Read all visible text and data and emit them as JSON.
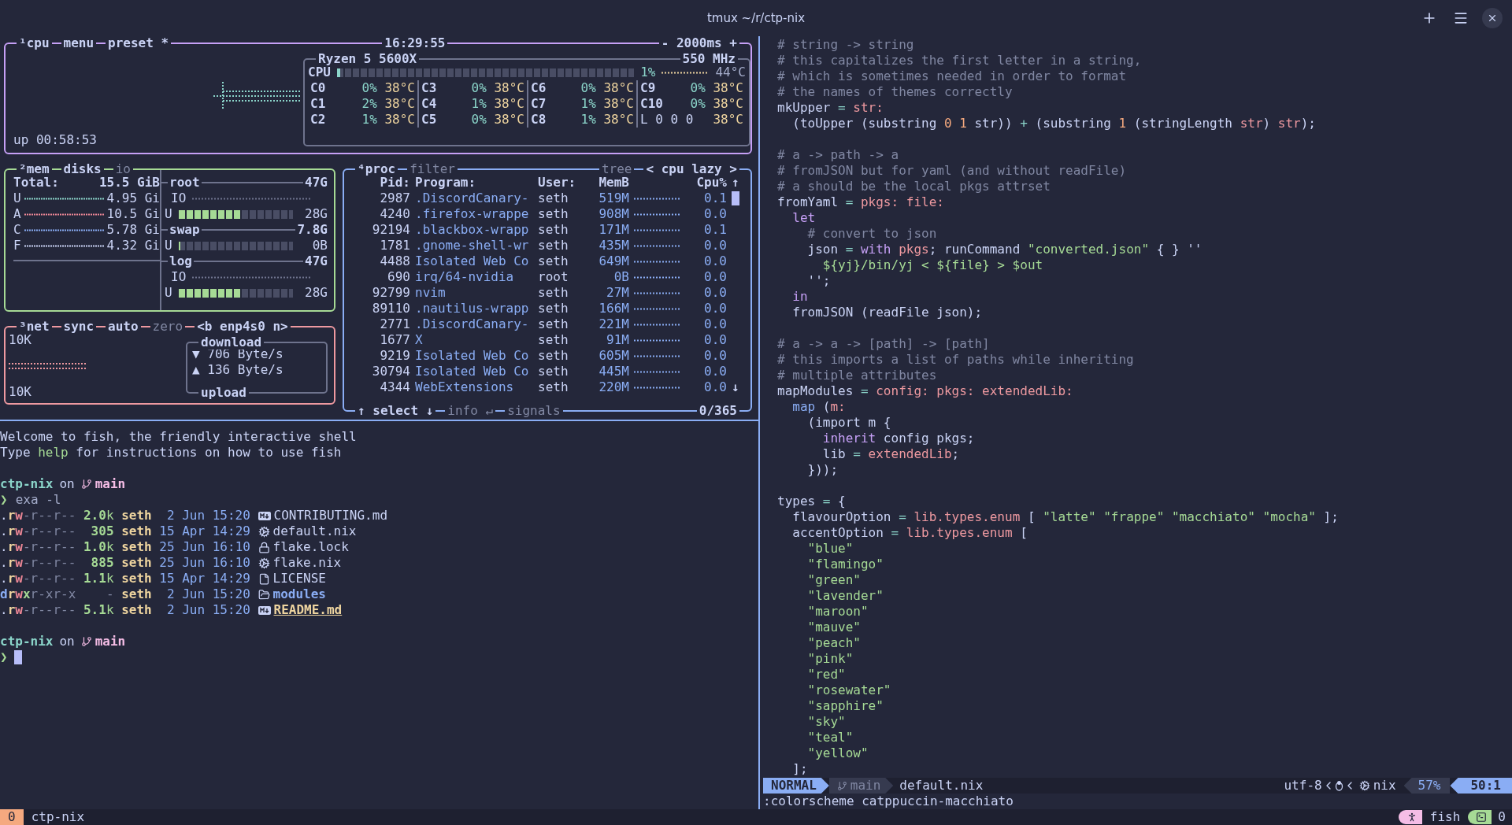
{
  "window": {
    "title": "tmux ~/r/ctp-nix"
  },
  "btop": {
    "cpu": {
      "labels": [
        {
          "text": "¹cpu",
          "active": true
        },
        {
          "text": "menu",
          "active": true
        },
        {
          "text": "preset *",
          "active": true
        }
      ],
      "clock": "16:29:55",
      "interval": "- 2000ms +",
      "uptime": "up 00:58:53",
      "model": "Ryzen 5 5600X",
      "frequency": "550 MHz",
      "total": {
        "label": "CPU",
        "level": 0.01,
        "percent": "1%",
        "temperature": "44°C"
      },
      "cores": [
        {
          "kind": "core",
          "label": "C0",
          "percent": "0%",
          "temperature": "38°C"
        },
        {
          "kind": "core",
          "label": "C1",
          "percent": "2%",
          "temperature": "38°C"
        },
        {
          "kind": "core",
          "label": "C2",
          "percent": "1%",
          "temperature": "38°C"
        },
        {
          "kind": "core",
          "label": "C3",
          "percent": "0%",
          "temperature": "38°C"
        },
        {
          "kind": "core",
          "label": "C4",
          "percent": "1%",
          "temperature": "38°C"
        },
        {
          "kind": "core",
          "label": "C5",
          "percent": "0%",
          "temperature": "38°C"
        },
        {
          "kind": "core",
          "label": "C6",
          "percent": "0%",
          "temperature": "38°C"
        },
        {
          "kind": "core",
          "label": "C7",
          "percent": "1%",
          "temperature": "38°C"
        },
        {
          "kind": "core",
          "label": "C8",
          "percent": "1%",
          "temperature": "38°C"
        },
        {
          "kind": "core",
          "label": "C9",
          "percent": "0%",
          "temperature": "38°C"
        },
        {
          "kind": "core",
          "label": "C10",
          "percent": "0%",
          "temperature": "38°C"
        },
        {
          "kind": "load",
          "label": "L 0 0 0",
          "temperature": "38°C"
        }
      ]
    },
    "mem": {
      "labels": [
        {
          "text": "²mem",
          "active": true
        },
        {
          "text": "disks",
          "active": true
        },
        {
          "text": "io",
          "active": false
        }
      ],
      "total_label": "Total:",
      "total": "15.5 GiB",
      "rows": [
        {
          "label": "U",
          "value": "4.95 Gi",
          "color": "#8bd5ca"
        },
        {
          "label": "A",
          "value": "10.5 Gi",
          "color": "#ed8796"
        },
        {
          "label": "C",
          "value": "5.78 Gi",
          "color": "#8aadf4"
        },
        {
          "label": "F",
          "value": "4.32 Gi",
          "color": "#cad3f5"
        }
      ],
      "disks": [
        {
          "name": "root",
          "size": "47G",
          "io_label": "IO",
          "used_label": "U",
          "level": 0.55,
          "used": "28G"
        },
        {
          "name": "swap",
          "size": "7.8G",
          "used_label": "U",
          "level": 0,
          "used": "0B"
        },
        {
          "name": "log",
          "size": "47G",
          "io_label": "IO",
          "used_label": "U",
          "level": 0.55,
          "used": "28G"
        }
      ]
    },
    "net": {
      "labels": [
        {
          "text": "³net",
          "active": true
        },
        {
          "text": "sync",
          "active": true
        },
        {
          "text": "auto",
          "active": true
        },
        {
          "text": "zero",
          "active": false
        },
        {
          "text": "<b enp4s0 n>",
          "active": true
        }
      ],
      "scale_top": "10K",
      "scale_bottom": "10K",
      "download_title": "download",
      "download": "▼ 706 Byte/s",
      "upload": "▲ 136 Byte/s",
      "upload_title": "upload"
    },
    "proc": {
      "labels_left": [
        {
          "text": "⁴proc",
          "active": true
        },
        {
          "text": "filter",
          "active": false
        }
      ],
      "labels_right": [
        {
          "text": "tree",
          "active": false
        },
        {
          "text": "< cpu lazy >",
          "active": true
        }
      ],
      "columns": [
        "Pid:",
        "Program:",
        "User:",
        "MemB",
        "Cpu%"
      ],
      "scroll_up": "↑",
      "scroll_down": "↓",
      "rows": [
        {
          "pid": "2987",
          "program": ".DiscordCanary-",
          "user": "seth",
          "memory": "519M",
          "cpu": "0.1"
        },
        {
          "pid": "4240",
          "program": ".firefox-wrappe",
          "user": "seth",
          "memory": "908M",
          "cpu": "0.0"
        },
        {
          "pid": "92194",
          "program": ".blackbox-wrapp",
          "user": "seth",
          "memory": "171M",
          "cpu": "0.1"
        },
        {
          "pid": "1781",
          "program": ".gnome-shell-wr",
          "user": "seth",
          "memory": "435M",
          "cpu": "0.0"
        },
        {
          "pid": "4488",
          "program": "Isolated Web Co",
          "user": "seth",
          "memory": "649M",
          "cpu": "0.0"
        },
        {
          "pid": "690",
          "program": "irq/64-nvidia",
          "user": "root",
          "memory": "0B",
          "cpu": "0.0"
        },
        {
          "pid": "92799",
          "program": "nvim",
          "user": "seth",
          "memory": "27M",
          "cpu": "0.0"
        },
        {
          "pid": "89110",
          "program": ".nautilus-wrapp",
          "user": "seth",
          "memory": "166M",
          "cpu": "0.0"
        },
        {
          "pid": "2771",
          "program": ".DiscordCanary-",
          "user": "seth",
          "memory": "221M",
          "cpu": "0.0"
        },
        {
          "pid": "1677",
          "program": "X",
          "user": "seth",
          "memory": "91M",
          "cpu": "0.0"
        },
        {
          "pid": "9219",
          "program": "Isolated Web Co",
          "user": "seth",
          "memory": "605M",
          "cpu": "0.0"
        },
        {
          "pid": "30794",
          "program": "Isolated Web Co",
          "user": "seth",
          "memory": "445M",
          "cpu": "0.0"
        },
        {
          "pid": "4344",
          "program": "WebExtensions",
          "user": "seth",
          "memory": "220M",
          "cpu": "0.0"
        }
      ],
      "footer": [
        {
          "text": "↑ select ↓",
          "active": true
        },
        {
          "text": "info ↵",
          "active": false
        },
        {
          "text": "signals",
          "active": false
        }
      ],
      "count": "0/365"
    }
  },
  "fish": {
    "lines": [
      {
        "kind": "text",
        "tokens": [
          {
            "text": "Welcome to fish, the friendly interactive shell"
          }
        ]
      },
      {
        "kind": "text",
        "tokens": [
          {
            "text": "Type "
          },
          {
            "text": "help",
            "kind": "green"
          },
          {
            "text": " for instructions on how to use fish"
          }
        ]
      },
      {
        "kind": "blank"
      },
      {
        "kind": "prompt",
        "directory": "ctp-nix",
        "joiner": "on",
        "branch": "main"
      },
      {
        "kind": "command",
        "symbol": "❯",
        "command": "exa -l"
      },
      {
        "kind": "listing",
        "files": [
          {
            "kind": "markdown",
            "perms": [
              {
                "text": "."
              },
              {
                "text": "r",
                "kind": "read"
              },
              {
                "text": "w",
                "kind": "write"
              },
              {
                "text": "-r--r--",
                "kind": "dim"
              }
            ],
            "size": [
              {
                "text": "2.0",
                "kind": "size"
              },
              {
                "text": "k",
                "kind": "green"
              }
            ],
            "user": "seth",
            "date": "2 Jun 15:20",
            "name": "CONTRIBUTING.md",
            "highlighted": false
          },
          {
            "kind": "nix",
            "perms": [
              {
                "text": "."
              },
              {
                "text": "r",
                "kind": "read"
              },
              {
                "text": "w",
                "kind": "write"
              },
              {
                "text": "-r--r--",
                "kind": "dim"
              }
            ],
            "size": [
              {
                "text": "305",
                "kind": "size"
              }
            ],
            "user": "seth",
            "date": "15 Apr 14:29",
            "name": "default.nix",
            "highlighted": false
          },
          {
            "kind": "lock",
            "perms": [
              {
                "text": "."
              },
              {
                "text": "r",
                "kind": "read"
              },
              {
                "text": "w",
                "kind": "write"
              },
              {
                "text": "-r--r--",
                "kind": "dim"
              }
            ],
            "size": [
              {
                "text": "1.0",
                "kind": "size"
              },
              {
                "text": "k",
                "kind": "green"
              }
            ],
            "user": "seth",
            "date": "25 Jun 16:10",
            "name": "flake.lock",
            "highlighted": false
          },
          {
            "kind": "nix",
            "perms": [
              {
                "text": "."
              },
              {
                "text": "r",
                "kind": "read"
              },
              {
                "text": "w",
                "kind": "write"
              },
              {
                "text": "-r--r--",
                "kind": "dim"
              }
            ],
            "size": [
              {
                "text": "885",
                "kind": "size"
              }
            ],
            "user": "seth",
            "date": "25 Jun 16:10",
            "name": "flake.nix",
            "highlighted": false
          },
          {
            "kind": "text",
            "perms": [
              {
                "text": "."
              },
              {
                "text": "r",
                "kind": "read"
              },
              {
                "text": "w",
                "kind": "write"
              },
              {
                "text": "-r--r--",
                "kind": "dim"
              }
            ],
            "size": [
              {
                "text": "1.1",
                "kind": "size"
              },
              {
                "text": "k",
                "kind": "green"
              }
            ],
            "user": "seth",
            "date": "15 Apr 14:29",
            "name": "LICENSE",
            "highlighted": false
          },
          {
            "kind": "directory",
            "perms": [
              {
                "text": "d",
                "kind": "dir"
              },
              {
                "text": "r",
                "kind": "read"
              },
              {
                "text": "w",
                "kind": "write"
              },
              {
                "text": "x",
                "kind": "exec"
              },
              {
                "text": "r-xr-x",
                "kind": "dim"
              }
            ],
            "size": [
              {
                "text": "-",
                "kind": "dim"
              }
            ],
            "user": "seth",
            "date": "2 Jun 15:20",
            "name": "modules",
            "highlighted": false
          },
          {
            "kind": "markdown",
            "perms": [
              {
                "text": "."
              },
              {
                "text": "r",
                "kind": "read"
              },
              {
                "text": "w",
                "kind": "write"
              },
              {
                "text": "-r--r--",
                "kind": "dim"
              }
            ],
            "size": [
              {
                "text": "5.1",
                "kind": "size"
              },
              {
                "text": "k",
                "kind": "green"
              }
            ],
            "user": "seth",
            "date": "2 Jun 15:20",
            "name": "README.md",
            "highlighted": true
          }
        ]
      },
      {
        "kind": "blank"
      },
      {
        "kind": "prompt",
        "directory": "ctp-nix",
        "joiner": "on",
        "branch": "main"
      },
      {
        "kind": "input",
        "symbol": "❯"
      }
    ]
  },
  "editor": {
    "lines": [
      {
        "kind": "code",
        "tokens": [
          {
            "text": "# string -> string",
            "kind": "comment"
          }
        ]
      },
      {
        "kind": "code",
        "tokens": [
          {
            "text": "# this capitalizes the first letter in a string,",
            "kind": "comment"
          }
        ]
      },
      {
        "kind": "code",
        "tokens": [
          {
            "text": "# which is sometimes needed in order to format",
            "kind": "comment"
          }
        ]
      },
      {
        "kind": "code",
        "tokens": [
          {
            "text": "# the names of themes correctly",
            "kind": "comment"
          }
        ]
      },
      {
        "kind": "code",
        "tokens": [
          {
            "text": "mkUpper"
          },
          {
            "text": " = ",
            "kind": "operator"
          },
          {
            "text": "str:",
            "kind": "param"
          }
        ]
      },
      {
        "kind": "code",
        "tokens": [
          {
            "text": "  (toUpper (substring "
          },
          {
            "text": "0 1",
            "kind": "number"
          },
          {
            "text": " str)) "
          },
          {
            "text": "+",
            "kind": "operator"
          },
          {
            "text": " (substring "
          },
          {
            "text": "1",
            "kind": "number"
          },
          {
            "text": " (stringLength "
          },
          {
            "text": "str",
            "kind": "param"
          },
          {
            "text": ") "
          },
          {
            "text": "str",
            "kind": "param"
          },
          {
            "text": ");"
          }
        ]
      },
      {
        "kind": "blank"
      },
      {
        "kind": "code",
        "tokens": [
          {
            "text": "# a -> path -> a",
            "kind": "comment"
          }
        ]
      },
      {
        "kind": "code",
        "tokens": [
          {
            "text": "# fromJSON but for yaml (and without readFile)",
            "kind": "comment"
          }
        ]
      },
      {
        "kind": "code",
        "tokens": [
          {
            "text": "# a should be the local pkgs attrset",
            "kind": "comment"
          }
        ]
      },
      {
        "kind": "code",
        "tokens": [
          {
            "text": "fromYaml"
          },
          {
            "text": " = ",
            "kind": "operator"
          },
          {
            "text": "pkgs: file:",
            "kind": "param"
          }
        ]
      },
      {
        "kind": "code",
        "tokens": [
          {
            "text": "  let",
            "kind": "keyword"
          }
        ]
      },
      {
        "kind": "code",
        "tokens": [
          {
            "text": "    # convert to json",
            "kind": "comment"
          }
        ]
      },
      {
        "kind": "code",
        "tokens": [
          {
            "text": "    json"
          },
          {
            "text": " = ",
            "kind": "operator"
          },
          {
            "text": "with",
            "kind": "keyword"
          },
          {
            "text": " pkgs",
            "kind": "param"
          },
          {
            "text": "; runCommand "
          },
          {
            "text": "\"converted.json\"",
            "kind": "string"
          },
          {
            "text": " { } ''"
          }
        ]
      },
      {
        "kind": "code",
        "tokens": [
          {
            "text": "      ${yj}/bin/yj < ${file} > $out",
            "kind": "string"
          }
        ]
      },
      {
        "kind": "code",
        "tokens": [
          {
            "text": "    '';"
          }
        ]
      },
      {
        "kind": "code",
        "tokens": [
          {
            "text": "  in",
            "kind": "keyword"
          }
        ]
      },
      {
        "kind": "code",
        "tokens": [
          {
            "text": "  fromJSON (readFile json);"
          }
        ]
      },
      {
        "kind": "blank"
      },
      {
        "kind": "code",
        "tokens": [
          {
            "text": "# a -> a -> [path] -> [path]",
            "kind": "comment"
          }
        ]
      },
      {
        "kind": "code",
        "tokens": [
          {
            "text": "# this imports a list of paths while inheriting",
            "kind": "comment"
          }
        ]
      },
      {
        "kind": "code",
        "tokens": [
          {
            "text": "# multiple attributes",
            "kind": "comment"
          }
        ]
      },
      {
        "kind": "code",
        "tokens": [
          {
            "text": "mapModules"
          },
          {
            "text": " = ",
            "kind": "operator"
          },
          {
            "text": "config: pkgs: extendedLib:",
            "kind": "param"
          }
        ]
      },
      {
        "kind": "code",
        "tokens": [
          {
            "text": "  map",
            "kind": "function"
          },
          {
            "text": " ("
          },
          {
            "text": "m:",
            "kind": "param"
          }
        ]
      },
      {
        "kind": "code",
        "tokens": [
          {
            "text": "    (import m {"
          }
        ]
      },
      {
        "kind": "code",
        "tokens": [
          {
            "text": "      inherit",
            "kind": "keyword"
          },
          {
            "text": " config pkgs;"
          }
        ]
      },
      {
        "kind": "code",
        "tokens": [
          {
            "text": "      lib"
          },
          {
            "text": " = ",
            "kind": "operator"
          },
          {
            "text": "extendedLib",
            "kind": "param"
          },
          {
            "text": ";"
          }
        ]
      },
      {
        "kind": "code",
        "tokens": [
          {
            "text": "    }));"
          }
        ]
      },
      {
        "kind": "blank"
      },
      {
        "kind": "code",
        "tokens": [
          {
            "text": "types"
          },
          {
            "text": " = ",
            "kind": "operator"
          },
          {
            "text": "{"
          }
        ]
      },
      {
        "kind": "code",
        "tokens": [
          {
            "text": "  flavourOption"
          },
          {
            "text": " = ",
            "kind": "operator"
          },
          {
            "text": "lib.types.enum",
            "kind": "param"
          },
          {
            "text": " [ "
          },
          {
            "text": "\"latte\" ",
            "kind": "string"
          },
          {
            "text": "\"frappe\" ",
            "kind": "string"
          },
          {
            "text": "\"macchiato\" ",
            "kind": "string"
          },
          {
            "text": "\"mocha\"",
            "kind": "string"
          },
          {
            "text": " ];"
          }
        ]
      },
      {
        "kind": "code",
        "tokens": [
          {
            "text": "  accentOption"
          },
          {
            "text": " = ",
            "kind": "operator"
          },
          {
            "text": "lib.types.enum",
            "kind": "param"
          },
          {
            "text": " ["
          }
        ]
      },
      {
        "kind": "code",
        "tokens": [
          {
            "text": "    \"blue\"",
            "kind": "string"
          }
        ]
      },
      {
        "kind": "code",
        "tokens": [
          {
            "text": "    \"flamingo\"",
            "kind": "string"
          }
        ]
      },
      {
        "kind": "code",
        "tokens": [
          {
            "text": "    \"green\"",
            "kind": "string"
          }
        ]
      },
      {
        "kind": "code",
        "tokens": [
          {
            "text": "    \"lavender\"",
            "kind": "string"
          }
        ]
      },
      {
        "kind": "code",
        "tokens": [
          {
            "text": "    \"maroon\"",
            "kind": "string"
          }
        ]
      },
      {
        "kind": "code",
        "tokens": [
          {
            "text": "    \"mauve\"",
            "kind": "string"
          }
        ]
      },
      {
        "kind": "code",
        "tokens": [
          {
            "text": "    \"peach\"",
            "kind": "string"
          }
        ]
      },
      {
        "kind": "code",
        "tokens": [
          {
            "text": "    \"pink\"",
            "kind": "string"
          }
        ]
      },
      {
        "kind": "code",
        "tokens": [
          {
            "text": "    \"red\"",
            "kind": "string"
          }
        ]
      },
      {
        "kind": "code",
        "tokens": [
          {
            "text": "    \"rosewater\"",
            "kind": "string"
          }
        ]
      },
      {
        "kind": "code",
        "tokens": [
          {
            "text": "    \"sapphire\"",
            "kind": "string"
          }
        ]
      },
      {
        "kind": "code",
        "tokens": [
          {
            "text": "    \"sky\"",
            "kind": "string"
          }
        ]
      },
      {
        "kind": "code",
        "tokens": [
          {
            "text": "    \"teal\"",
            "kind": "string"
          }
        ]
      },
      {
        "kind": "code",
        "tokens": [
          {
            "text": "    \"yellow\"",
            "kind": "string"
          }
        ]
      },
      {
        "kind": "code",
        "tokens": [
          {
            "text": "  ];"
          }
        ]
      }
    ],
    "status": {
      "mode": "NORMAL",
      "branch": "main",
      "file": "default.nix",
      "encoding": "utf-8",
      "filetype": "nix",
      "percent": "57%",
      "position": "50:1"
    },
    "command": ":colorscheme catppuccin-macchiato"
  },
  "tmux": {
    "window_index": "0",
    "window_name": "ctp-nix",
    "shell": "fish",
    "pane_count": "0"
  }
}
